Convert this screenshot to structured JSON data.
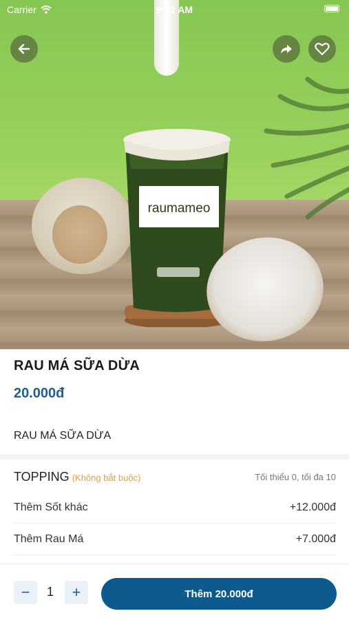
{
  "status_bar": {
    "carrier": "Carrier",
    "time": "9:42 AM"
  },
  "header": {
    "back_icon": "arrow-left-icon",
    "share_icon": "share-arrow-icon",
    "favorite_icon": "heart-icon"
  },
  "hero": {
    "cup_brand": "raumameo"
  },
  "product": {
    "name": "RAU MÁ SỮA DỪA",
    "price": "20.000đ",
    "description": "RAU MÁ SỮA DỪA"
  },
  "topping": {
    "label": "TOPPING",
    "optional_note": "(Không bắt buộc)",
    "limit": "Tối thiểu 0, tối đa 10",
    "items": [
      {
        "name": "Thêm Sốt khác",
        "price": "+12.000đ"
      },
      {
        "name": "Thêm Rau Má",
        "price": "+7.000đ"
      }
    ]
  },
  "bottom_bar": {
    "minus": "−",
    "quantity": "1",
    "plus": "+",
    "add_label": "Thêm 20.000đ"
  },
  "colors": {
    "accent": "#0c5a8e",
    "price": "#1f5e8f",
    "optional": "#e0a23a"
  }
}
